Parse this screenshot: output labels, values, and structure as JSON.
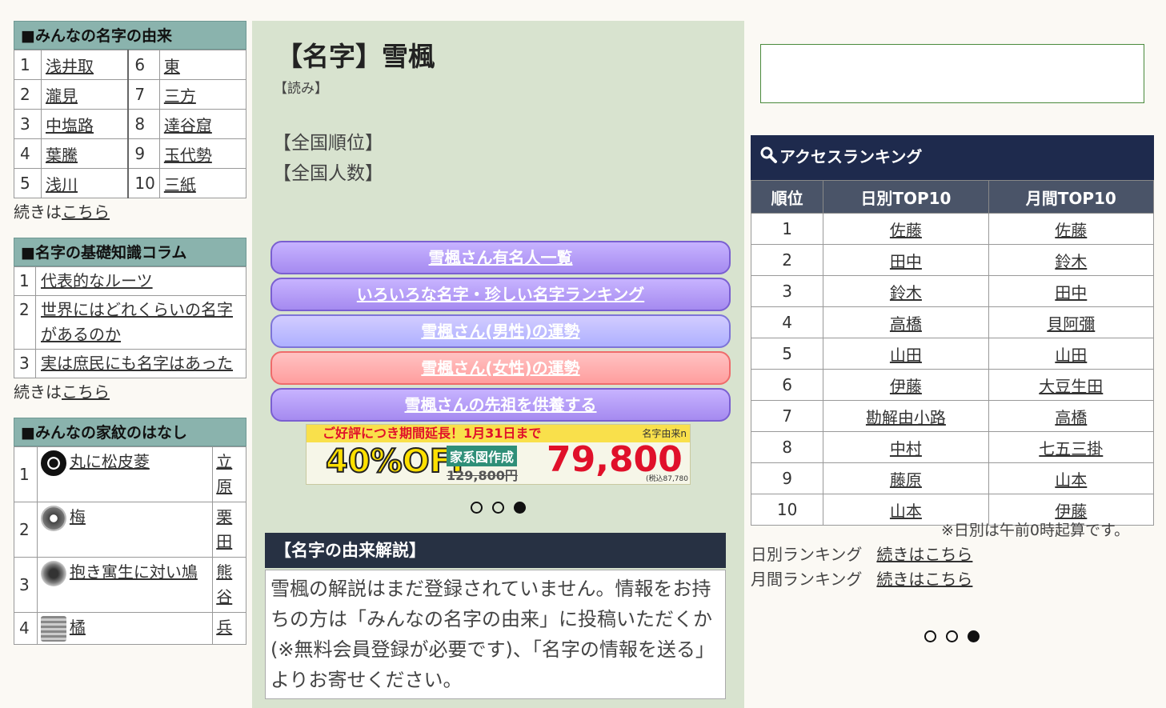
{
  "names_box": {
    "title": "■みんなの名字の由来",
    "items": [
      {
        "num": "1",
        "name": "浅井取"
      },
      {
        "num": "2",
        "name": "瀧見"
      },
      {
        "num": "3",
        "name": "中塩路"
      },
      {
        "num": "4",
        "name": "葉騰"
      },
      {
        "num": "5",
        "name": "浅川"
      },
      {
        "num": "6",
        "name": "東"
      },
      {
        "num": "7",
        "name": "三方"
      },
      {
        "num": "8",
        "name": "達谷窟"
      },
      {
        "num": "9",
        "name": "玉代勢"
      },
      {
        "num": "10",
        "name": "三紙"
      }
    ],
    "more_prefix": "続きは",
    "more_link": "こちら"
  },
  "column_box": {
    "title": "■名字の基礎知識コラム",
    "items": [
      {
        "num": "1",
        "text": "代表的なルーツ"
      },
      {
        "num": "2",
        "text": "世界にはどれくらいの名字があるのか"
      },
      {
        "num": "3",
        "text": "実は庶民にも名字はあった"
      }
    ],
    "more_prefix": "続きは",
    "more_link": "こちら"
  },
  "kamon_box": {
    "title": "■みんなの家紋のはなし",
    "items": [
      {
        "num": "1",
        "kamon": "丸に松皮菱",
        "name": "立原",
        "icon": "maru-ni-matsukawabishi-icon"
      },
      {
        "num": "2",
        "kamon": "梅",
        "name": "栗田",
        "icon": "ume-icon"
      },
      {
        "num": "3",
        "kamon": "抱き寓生に対い鳩",
        "name": "熊谷",
        "icon": "dakiyadorigi-icon"
      },
      {
        "num": "4",
        "kamon": "橘",
        "name": "兵",
        "icon": "tachibana-icon"
      }
    ]
  },
  "main": {
    "title": "【名字】雪楓",
    "yomi": "【読み】",
    "rank_label": "【全国順位】",
    "count_label": "【全国人数】",
    "buttons": [
      "雪楓さん有名人一覧",
      "いろいろな名字・珍しい名字ランキング",
      "雪楓さん(男性)の運勢",
      "雪楓さん(女性)の運勢",
      "雪楓さんの先祖を供養する"
    ],
    "banner": {
      "headline": "ご好評につき期間延長！1月31日まで",
      "tag": "名字由来n",
      "off": "40%OFF",
      "service": "家系図作成",
      "old_price": "129,800円",
      "price": "79,800円",
      "tax": "(税込87,780"
    },
    "explain_title": "【名字の由来解説】",
    "explain_text": "雪楓の解説はまだ登録されていません。情報をお持ちの方は「みんなの名字の由来」に投稿いただくか(※無料会員登録が必要です)、「名字の情報を送る」よりお寄せください。"
  },
  "ranking": {
    "title": "アクセスランキング",
    "headers": [
      "順位",
      "日別TOP10",
      "月間TOP10"
    ],
    "rows": [
      [
        "1",
        "佐藤",
        "佐藤"
      ],
      [
        "2",
        "田中",
        "鈴木"
      ],
      [
        "3",
        "鈴木",
        "田中"
      ],
      [
        "4",
        "高橋",
        "貝阿彌"
      ],
      [
        "5",
        "山田",
        "山田"
      ],
      [
        "6",
        "伊藤",
        "大豆生田"
      ],
      [
        "7",
        "勘解由小路",
        "高橋"
      ],
      [
        "8",
        "中村",
        "七五三掛"
      ],
      [
        "9",
        "藤原",
        "山本"
      ],
      [
        "10",
        "山本",
        "伊藤"
      ]
    ],
    "note": "※日別は午前0時起算です。",
    "daily_label": "日別ランキング",
    "monthly_label": "月間ランキング",
    "more_link": "続きはこちら"
  },
  "colors": {
    "header_teal": "#8ab3ad",
    "main_bg": "#d8e3cf",
    "navy": "#1e2a4d",
    "btn_purple": "#a58af0",
    "btn_pink": "#ff9e9e"
  }
}
